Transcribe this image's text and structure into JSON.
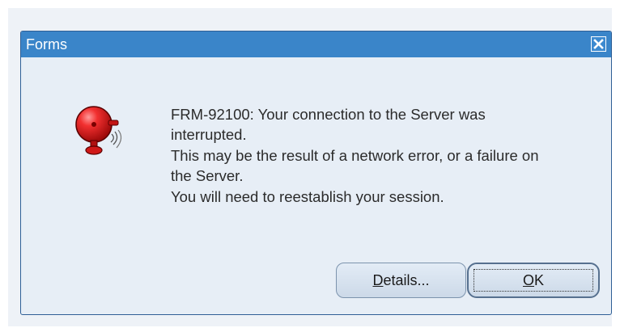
{
  "window": {
    "title": "Forms",
    "close_icon": "close-icon"
  },
  "icon": {
    "name": "alarm-bell-icon",
    "color": "#e52222"
  },
  "message": {
    "lines": [
      "FRM-92100: Your connection to the Server was",
      "interrupted.",
      "This may be the result of a network error, or a failure on",
      "the Server.",
      "You will need to reestablish your session."
    ]
  },
  "buttons": {
    "details": {
      "mnemonic": "D",
      "rest": "etails..."
    },
    "ok": {
      "mnemonic": "O",
      "rest": "K"
    }
  },
  "colors": {
    "titlebar": "#3a85c9",
    "dialog_bg": "#e7eef6",
    "button_bg": "#d6e1ee"
  }
}
